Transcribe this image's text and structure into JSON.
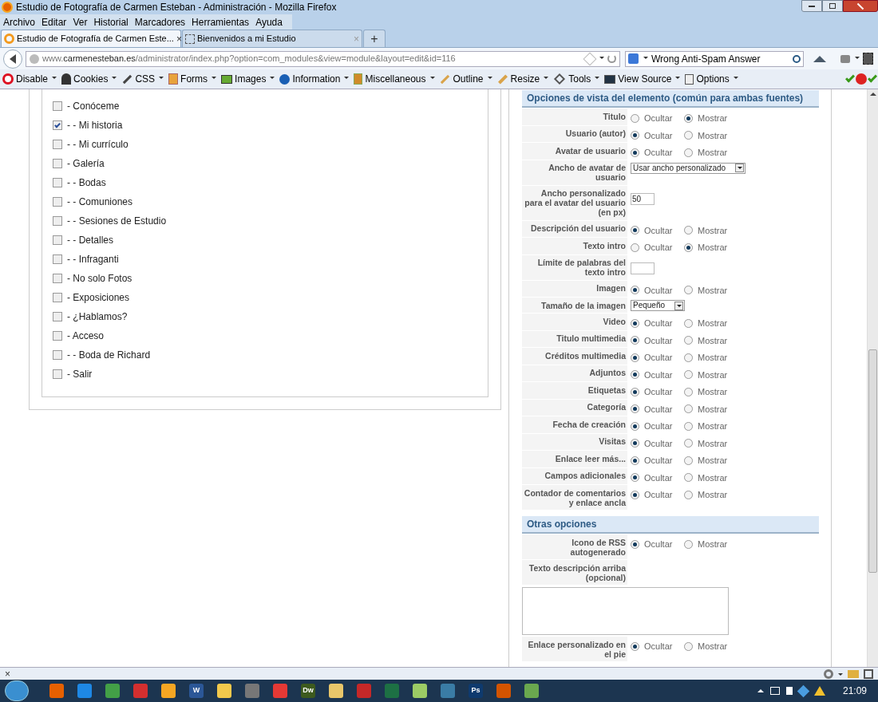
{
  "window": {
    "title": "Estudio de Fotografía de Carmen Esteban - Administración - Mozilla Firefox"
  },
  "menu": [
    "Archivo",
    "Editar",
    "Ver",
    "Historial",
    "Marcadores",
    "Herramientas",
    "Ayuda"
  ],
  "tabs": [
    {
      "label": "Estudio de Fotografía de Carmen Este...",
      "selected": true,
      "close": "×"
    },
    {
      "label": "Bienvenidos a mi Estudio",
      "selected": false,
      "close": "×"
    }
  ],
  "new_tab": "+",
  "address": {
    "prefix": "www.",
    "domain": "carmenesteban.es",
    "path": "/administrator/index.php?option=com_modules&view=module&layout=edit&id=116"
  },
  "search": {
    "value": "Wrong Anti-Spam Answer"
  },
  "toolbar": [
    "Disable",
    "Cookies",
    "CSS",
    "Forms",
    "Images",
    "Information",
    "Miscellaneous",
    "Outline",
    "Resize",
    "Tools",
    "View Source",
    "Options"
  ],
  "checklist": [
    {
      "label": "- Conóceme",
      "checked": false
    },
    {
      "label": "- - Mi historia",
      "checked": true
    },
    {
      "label": "- - Mi currículo",
      "checked": false
    },
    {
      "label": "- Galería",
      "checked": false
    },
    {
      "label": "- - Bodas",
      "checked": false
    },
    {
      "label": "- - Comuniones",
      "checked": false
    },
    {
      "label": "- - Sesiones de Estudio",
      "checked": false
    },
    {
      "label": "- - Detalles",
      "checked": false
    },
    {
      "label": "- - Infraganti",
      "checked": false
    },
    {
      "label": "- No solo Fotos",
      "checked": false
    },
    {
      "label": "- Exposiciones",
      "checked": false
    },
    {
      "label": "- ¿Hablamos?",
      "checked": false
    },
    {
      "label": "- Acceso",
      "checked": false
    },
    {
      "label": "- - Boda de Richard",
      "checked": false
    },
    {
      "label": "- Salir",
      "checked": false
    }
  ],
  "sections": [
    {
      "title": "Opciones de vista del elemento (común para ambas fuentes)",
      "rows": [
        {
          "kind": "radio",
          "label": "Titulo",
          "options": [
            {
              "label": "Ocultar",
              "selected": false
            },
            {
              "label": "Mostrar",
              "selected": true
            }
          ]
        },
        {
          "kind": "radio",
          "label": "Usuario (autor)",
          "options": [
            {
              "label": "Ocultar",
              "selected": true
            },
            {
              "label": "Mostrar",
              "selected": false
            }
          ]
        },
        {
          "kind": "radio",
          "label": "Avatar de usuario",
          "options": [
            {
              "label": "Ocultar",
              "selected": true
            },
            {
              "label": "Mostrar",
              "selected": false
            }
          ]
        },
        {
          "kind": "select",
          "label": "Ancho de avatar de usuario",
          "value": "Usar ancho personalizado"
        },
        {
          "kind": "text",
          "label": "Ancho personalizado para el avatar del usuario (en px)",
          "value": "50"
        },
        {
          "kind": "radio",
          "label": "Descripción del usuario",
          "options": [
            {
              "label": "Ocultar",
              "selected": true
            },
            {
              "label": "Mostrar",
              "selected": false
            }
          ]
        },
        {
          "kind": "radio",
          "label": "Texto intro",
          "options": [
            {
              "label": "Ocultar",
              "selected": false
            },
            {
              "label": "Mostrar",
              "selected": true
            }
          ]
        },
        {
          "kind": "text",
          "label": "Límite de palabras del texto intro"
        },
        {
          "kind": "radio",
          "label": "Imagen",
          "options": [
            {
              "label": "Ocultar",
              "selected": true
            },
            {
              "label": "Mostrar",
              "selected": false
            }
          ]
        },
        {
          "kind": "select",
          "label": "Tamaño de la imagen",
          "value": "Pequeño"
        },
        {
          "kind": "radio",
          "label": "Video",
          "options": [
            {
              "label": "Ocultar",
              "selected": true
            },
            {
              "label": "Mostrar",
              "selected": false
            }
          ]
        },
        {
          "kind": "radio",
          "label": "Titulo multimedia",
          "options": [
            {
              "label": "Ocultar",
              "selected": true
            },
            {
              "label": "Mostrar",
              "selected": false
            }
          ]
        },
        {
          "kind": "radio",
          "label": "Créditos multimedia",
          "options": [
            {
              "label": "Ocultar",
              "selected": true
            },
            {
              "label": "Mostrar",
              "selected": false
            }
          ]
        },
        {
          "kind": "radio",
          "label": "Adjuntos",
          "options": [
            {
              "label": "Ocultar",
              "selected": true
            },
            {
              "label": "Mostrar",
              "selected": false
            }
          ]
        },
        {
          "kind": "radio",
          "label": "Etiquetas",
          "options": [
            {
              "label": "Ocultar",
              "selected": true
            },
            {
              "label": "Mostrar",
              "selected": false
            }
          ]
        },
        {
          "kind": "radio",
          "label": "Categoría",
          "options": [
            {
              "label": "Ocultar",
              "selected": true
            },
            {
              "label": "Mostrar",
              "selected": false
            }
          ]
        },
        {
          "kind": "radio",
          "label": "Fecha de creación",
          "options": [
            {
              "label": "Ocultar",
              "selected": true
            },
            {
              "label": "Mostrar",
              "selected": false
            }
          ]
        },
        {
          "kind": "radio",
          "label": "Visitas",
          "options": [
            {
              "label": "Ocultar",
              "selected": true
            },
            {
              "label": "Mostrar",
              "selected": false
            }
          ]
        },
        {
          "kind": "radio",
          "label": "Enlace leer más...",
          "options": [
            {
              "label": "Ocultar",
              "selected": true
            },
            {
              "label": "Mostrar",
              "selected": false
            }
          ]
        },
        {
          "kind": "radio",
          "label": "Campos adicionales",
          "options": [
            {
              "label": "Ocultar",
              "selected": true
            },
            {
              "label": "Mostrar",
              "selected": false
            }
          ]
        },
        {
          "kind": "radio",
          "label": "Contador de comentarios y enlace ancla",
          "options": [
            {
              "label": "Ocultar",
              "selected": true
            },
            {
              "label": "Mostrar",
              "selected": false
            }
          ]
        }
      ]
    },
    {
      "title": "Otras opciones",
      "rows": [
        {
          "kind": "radio",
          "label": "Icono de RSS autogenerado",
          "options": [
            {
              "label": "Ocultar",
              "selected": true
            },
            {
              "label": "Mostrar",
              "selected": false
            }
          ]
        },
        {
          "kind": "label",
          "label": "Texto descripción arriba (opcional)"
        },
        {
          "kind": "textarea"
        },
        {
          "kind": "radio",
          "label": "Enlace personalizado en el pie",
          "options": [
            {
              "label": "Ocultar",
              "selected": true
            },
            {
              "label": "Mostrar",
              "selected": false
            }
          ]
        }
      ]
    }
  ],
  "addon_bar": {
    "close": "×"
  },
  "taskbar": {
    "apps": [
      {
        "color": "#e66000"
      },
      {
        "color": "#1e88e5"
      },
      {
        "color": "#43a047"
      },
      {
        "color": "#d32f2f"
      },
      {
        "color": "#f5a623"
      },
      {
        "label": "W",
        "color": "#2b5797"
      },
      {
        "color": "#f2c94c"
      },
      {
        "color": "#777777"
      },
      {
        "color": "#e53935"
      },
      {
        "label": "Dw",
        "color": "#3d5a1e"
      },
      {
        "color": "#e8c66a"
      },
      {
        "color": "#c62828"
      },
      {
        "color": "#1d7044"
      },
      {
        "color": "#9ccc65"
      },
      {
        "color": "#3a7ca5"
      },
      {
        "label": "Ps",
        "color": "#0e3a6e"
      },
      {
        "color": "#d35400"
      },
      {
        "color": "#6aa84f"
      }
    ],
    "time": "21:09"
  }
}
